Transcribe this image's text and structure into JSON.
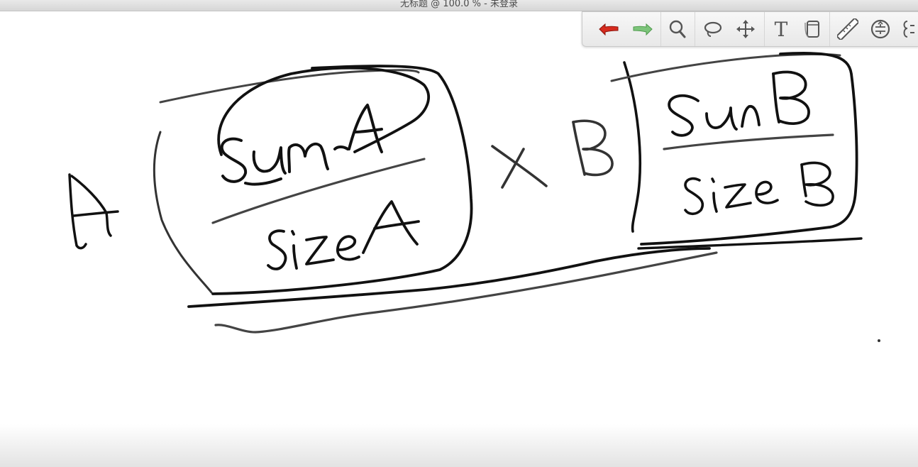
{
  "window": {
    "title": "无标题 @ 100.0 % - 未登录"
  },
  "toolbar": {
    "tools": [
      {
        "id": "undo",
        "icon": "undo-arrow-icon",
        "color": "#d62b1e"
      },
      {
        "id": "redo",
        "icon": "redo-arrow-icon",
        "color": "#7cc47a"
      },
      {
        "id": "zoom",
        "icon": "magnifier-icon"
      },
      {
        "id": "lasso",
        "icon": "lasso-icon"
      },
      {
        "id": "move",
        "icon": "move-arrows-icon"
      },
      {
        "id": "text",
        "icon": "text-tool-icon",
        "label": "T"
      },
      {
        "id": "eraser",
        "icon": "eraser-icon"
      },
      {
        "id": "ruler",
        "icon": "ruler-icon"
      },
      {
        "id": "shape",
        "icon": "shape-tool-icon"
      },
      {
        "id": "selection",
        "icon": "selection-tool-icon"
      }
    ]
  },
  "canvas": {
    "ink_color": "#111111",
    "ink_gray": "#444444"
  }
}
